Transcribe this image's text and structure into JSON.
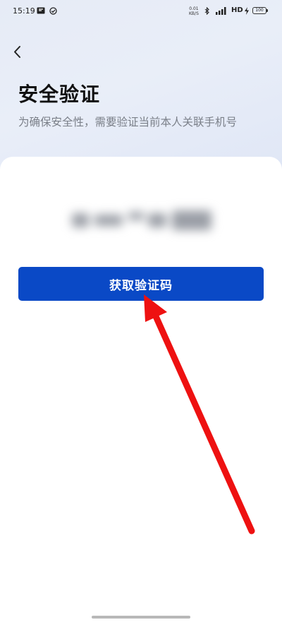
{
  "status_bar": {
    "time": "15:19",
    "net_speed_value": "0.01",
    "net_speed_unit": "KB/S",
    "network_type": "HD",
    "battery": "100",
    "icons": [
      "message-icon",
      "check-circle-icon",
      "bluetooth-icon",
      "signal-icon",
      "charging-icon",
      "battery-icon"
    ]
  },
  "header": {
    "back_icon": "chevron-left-icon",
    "title": "安全验证",
    "subtitle": "为确保安全性，需要验证当前本人关联手机号"
  },
  "verification": {
    "phone_number_state": "blurred",
    "get_code_button_label": "获取验证码"
  },
  "annotation": {
    "arrow_color": "#ee1111",
    "points_to": "get-code-button"
  },
  "colors": {
    "accent": "#0a49c6",
    "header_background": "#e6ebf6"
  }
}
